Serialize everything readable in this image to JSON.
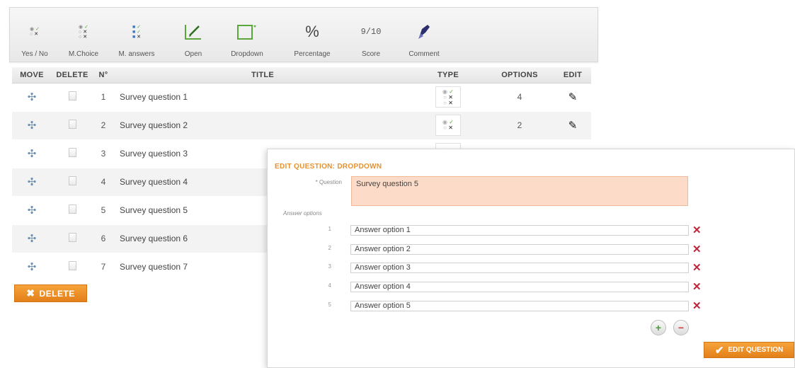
{
  "toolbar": {
    "items": [
      {
        "label": "Yes / No",
        "icon": "yes-no-icon"
      },
      {
        "label": "M.Choice",
        "icon": "multiple-choice-icon"
      },
      {
        "label": "M. answers",
        "icon": "multiple-answers-icon"
      },
      {
        "label": "Open",
        "icon": "open-question-icon"
      },
      {
        "label": "Dropdown",
        "icon": "dropdown-icon"
      },
      {
        "label": "Percentage",
        "icon": "percentage-icon"
      },
      {
        "label": "Score",
        "icon": "score-icon"
      },
      {
        "label": "Comment",
        "icon": "comment-icon"
      }
    ],
    "percentage_glyph": "%",
    "score_glyph": "9/10"
  },
  "table": {
    "headers": {
      "move": "MOVE",
      "delete": "DELETE",
      "number": "N°",
      "title": "TITLE",
      "type": "TYPE",
      "options": "OPTIONS",
      "edit": "EDIT"
    },
    "rows": [
      {
        "n": "1",
        "title": "Survey question 1",
        "type": "multiple-choice",
        "options": "4"
      },
      {
        "n": "2",
        "title": "Survey question 2",
        "type": "yes-no",
        "options": "2"
      },
      {
        "n": "3",
        "title": "Survey question 3",
        "type": "yes-no",
        "options": ""
      },
      {
        "n": "4",
        "title": "Survey question 4",
        "type": "",
        "options": ""
      },
      {
        "n": "5",
        "title": "Survey question 5",
        "type": "",
        "options": ""
      },
      {
        "n": "6",
        "title": "Survey question 6",
        "type": "",
        "options": ""
      },
      {
        "n": "7",
        "title": "Survey question 7",
        "type": "",
        "options": ""
      }
    ]
  },
  "delete_button": {
    "label": "DELETE"
  },
  "dialog": {
    "title": "EDIT QUESTION: DROPDOWN",
    "question_label": "* Question",
    "question_value": "Survey question 5",
    "answers_label": "Answer options",
    "answers": [
      {
        "n": "1",
        "value": "Answer option 1"
      },
      {
        "n": "2",
        "value": "Answer option 2"
      },
      {
        "n": "3",
        "value": "Answer option 3"
      },
      {
        "n": "4",
        "value": "Answer option 4"
      },
      {
        "n": "5",
        "value": "Answer option 5"
      }
    ],
    "submit_label": "EDIT QUESTION"
  },
  "colors": {
    "accent": "#e8912b",
    "danger": "#c0243a",
    "question_bg": "#fcdcc8"
  }
}
